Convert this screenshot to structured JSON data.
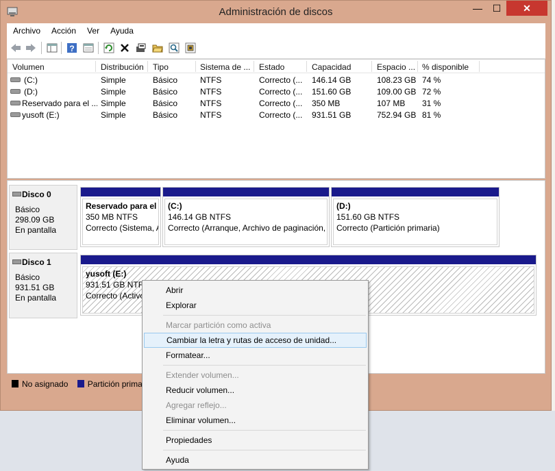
{
  "window": {
    "title": "Administración de discos",
    "minimize": "—",
    "maximize": "☐",
    "close": "✕"
  },
  "menu": [
    "Archivo",
    "Acción",
    "Ver",
    "Ayuda"
  ],
  "toolbar_icons": [
    "back-arrow-icon",
    "forward-arrow-icon",
    "console-tree-icon",
    "help-icon",
    "properties-icon",
    "refresh-icon",
    "delete-icon",
    "new-volume-icon",
    "open-folder-icon",
    "search-icon",
    "settings-icon"
  ],
  "volume_list": {
    "columns": [
      "Volumen",
      "Distribución",
      "Tipo",
      "Sistema de ...",
      "Estado",
      "Capacidad",
      "Espacio ...",
      "% disponible"
    ],
    "rows": [
      [
        "(C:)",
        "Simple",
        "Básico",
        "NTFS",
        "Correcto (...",
        "146.14 GB",
        "108.23 GB",
        "74 %"
      ],
      [
        "(D:)",
        "Simple",
        "Básico",
        "NTFS",
        "Correcto (...",
        "151.60 GB",
        "109.00 GB",
        "72 %"
      ],
      [
        "Reservado para el ...",
        "Simple",
        "Básico",
        "NTFS",
        "Correcto (...",
        "350 MB",
        "107 MB",
        "31 %"
      ],
      [
        "yusoft  (E:)",
        "Simple",
        "Básico",
        "NTFS",
        "Correcto (...",
        "931.51 GB",
        "752.94 GB",
        "81 %"
      ]
    ]
  },
  "disks": [
    {
      "name": "Disco 0",
      "type": "Básico",
      "size": "298.09 GB",
      "status": "En pantalla",
      "partitions": [
        {
          "title": "Reservado para el s",
          "size": "350 MB NTFS",
          "status": "Correcto (Sistema, A"
        },
        {
          "title": "(C:)",
          "size": "146.14 GB NTFS",
          "status": "Correcto (Arranque, Archivo de paginación,"
        },
        {
          "title": "(D:)",
          "size": "151.60 GB NTFS",
          "status": "Correcto (Partición primaria)"
        }
      ]
    },
    {
      "name": "Disco 1",
      "type": "Básico",
      "size": "931.51 GB",
      "status": "En pantalla",
      "partitions": [
        {
          "title": "yusoft  (E:)",
          "size": "931.51 GB NTFS",
          "status": "Correcto (Activo"
        }
      ]
    }
  ],
  "legend": [
    {
      "label": "No asignado",
      "color": "#000000"
    },
    {
      "label": "Partición primari",
      "color": "#1a1a8c"
    }
  ],
  "context_menu": [
    {
      "label": "Abrir",
      "enabled": true
    },
    {
      "label": "Explorar",
      "enabled": true
    },
    {
      "label": "Marcar partición como activa",
      "enabled": false
    },
    {
      "label": "Cambiar la letra y rutas de acceso de unidad...",
      "enabled": true,
      "highlighted": true
    },
    {
      "label": "Formatear...",
      "enabled": true
    },
    {
      "label": "Extender volumen...",
      "enabled": false
    },
    {
      "label": "Reducir volumen...",
      "enabled": true
    },
    {
      "label": "Agregar reflejo...",
      "enabled": false
    },
    {
      "label": "Eliminar volumen...",
      "enabled": true
    },
    {
      "label": "Propiedades",
      "enabled": true
    },
    {
      "label": "Ayuda",
      "enabled": true
    }
  ],
  "colors": {
    "window_frame": "#d9a88e",
    "close_button": "#c7372f",
    "primary_partition": "#1a1a8c",
    "highlight": "#e5f1fb"
  }
}
